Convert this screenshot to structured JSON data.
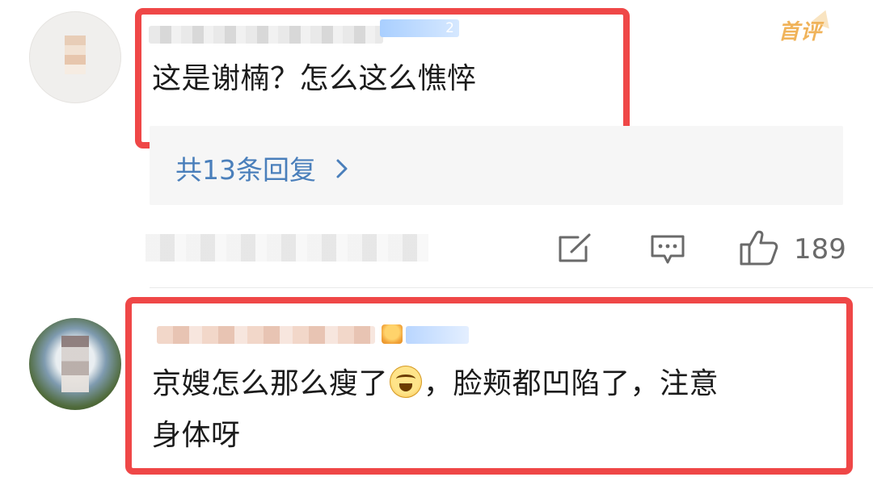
{
  "comment1": {
    "level_badge": "2",
    "text": "这是谢楠？怎么这么憔悴",
    "first_badge": "首评",
    "reply_link": "共13条回复",
    "like_count": "189"
  },
  "comment2": {
    "text_main": "京嫂怎么那么瘦了",
    "text_after_emoji": "，脸颊都凹陷了，注意",
    "text_line2": "身体呀"
  },
  "icons": {
    "share": "share-icon",
    "comment": "comment-icon",
    "like": "like-icon",
    "reply_chevron": "chevron-right-icon",
    "emoji": "laugh-cry-emoji-icon"
  },
  "colors": {
    "highlight_border": "#ef4747",
    "link_blue": "#4a7fbb",
    "badge_gold": "#f0b35a"
  }
}
